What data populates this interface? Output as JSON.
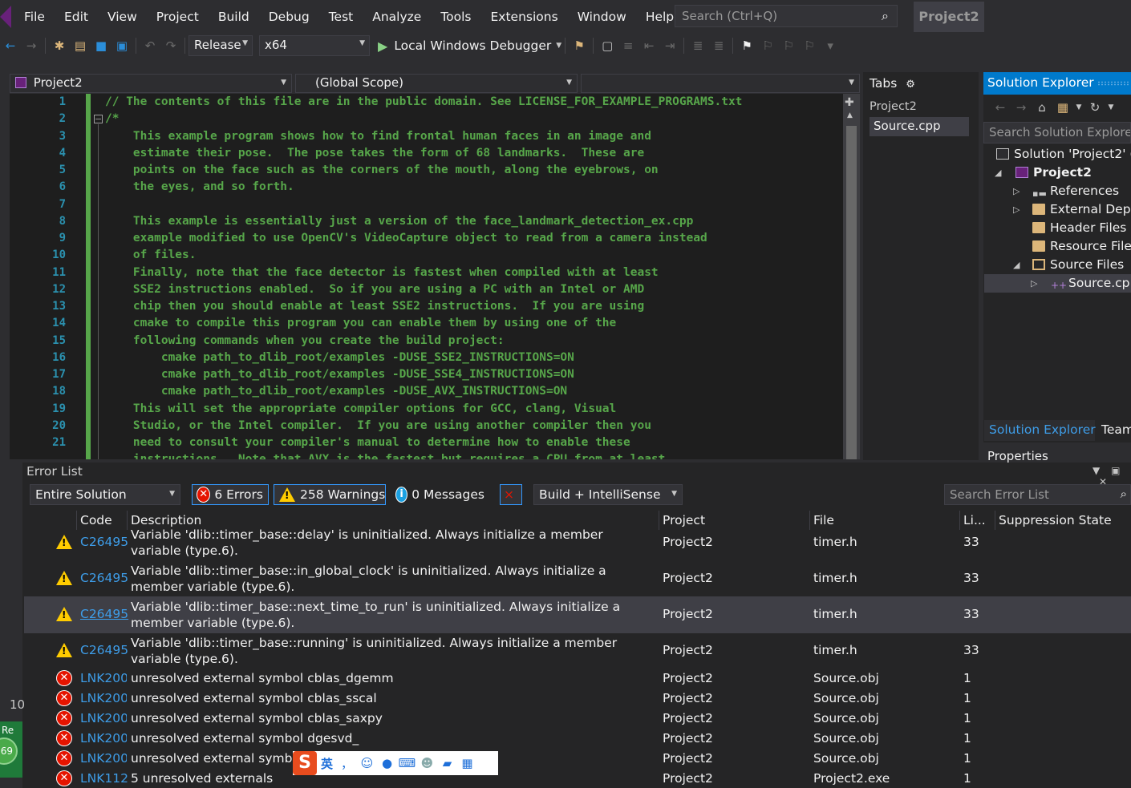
{
  "menu": {
    "items": [
      "File",
      "Edit",
      "View",
      "Project",
      "Build",
      "Debug",
      "Test",
      "Analyze",
      "Tools",
      "Extensions",
      "Window",
      "Help"
    ],
    "search_placeholder": "Search (Ctrl+Q)",
    "project_name": "Project2"
  },
  "toolbar": {
    "configuration": "Release",
    "platform": "x64",
    "run_label": "Local Windows Debugger"
  },
  "editor_nav": {
    "project": "Project2",
    "scope": "(Global Scope)",
    "member": ""
  },
  "editor": {
    "line_numbers": [
      "1",
      "2",
      "3",
      "4",
      "5",
      "6",
      "7",
      "8",
      "9",
      "10",
      "11",
      "12",
      "13",
      "14",
      "15",
      "16",
      "17",
      "18",
      "19",
      "20",
      "21"
    ],
    "lines": [
      "// The contents of this file are in the public domain. See LICENSE_FOR_EXAMPLE_PROGRAMS.txt",
      "/*",
      "    This example program shows how to find frontal human faces in an image and",
      "    estimate their pose.  The pose takes the form of 68 landmarks.  These are",
      "    points on the face such as the corners of the mouth, along the eyebrows, on",
      "    the eyes, and so forth.",
      "",
      "    This example is essentially just a version of the face_landmark_detection_ex.cpp",
      "    example modified to use OpenCV's VideoCapture object to read from a camera instead",
      "    of files.",
      "    Finally, note that the face detector is fastest when compiled with at least",
      "    SSE2 instructions enabled.  So if you are using a PC with an Intel or AMD",
      "    chip then you should enable at least SSE2 instructions.  If you are using",
      "    cmake to compile this program you can enable them by using one of the",
      "    following commands when you create the build project:",
      "        cmake path_to_dlib_root/examples -DUSE_SSE2_INSTRUCTIONS=ON",
      "        cmake path_to_dlib_root/examples -DUSE_SSE4_INSTRUCTIONS=ON",
      "        cmake path_to_dlib_root/examples -DUSE_AVX_INSTRUCTIONS=ON",
      "    This will set the appropriate compiler options for GCC, clang, Visual",
      "    Studio, or the Intel compiler.  If you are using another compiler then you",
      "    need to consult your compiler's manual to determine how to enable these",
      "    instructions.  Note that AVX is the fastest but requires a CPU from at least"
    ]
  },
  "tabs_panel": {
    "title": "Tabs",
    "project": "Project2",
    "file": "Source.cpp"
  },
  "solution_explorer": {
    "title": "Solution Explorer",
    "search_placeholder": "Search Solution Explorer",
    "solution": "Solution 'Project2' (",
    "project": "Project2",
    "items": [
      "References",
      "External Depe",
      "Header Files",
      "Resource File",
      "Source Files",
      "Source.cp"
    ],
    "bottom_tab_1": "Solution Explorer",
    "bottom_tab_2": "Team",
    "properties_title": "Properties"
  },
  "error_list": {
    "title": "Error List",
    "scope_filter": "Entire Solution",
    "errors_label": "6 Errors",
    "warnings_label": "258 Warnings",
    "messages_label": "0 Messages",
    "build_filter": "Build + IntelliSense",
    "search_placeholder": "Search Error List",
    "columns": [
      "Code",
      "Description",
      "Project",
      "File",
      "Li...",
      "Suppression State"
    ],
    "rows": [
      {
        "type": "warning",
        "code": "C26495",
        "description": "Variable 'dlib::timer_base::delay' is uninitialized. Always initialize a member variable (type.6).",
        "project": "Project2",
        "file": "timer.h",
        "line": "33"
      },
      {
        "type": "warning",
        "code": "C26495",
        "description": "Variable 'dlib::timer_base::in_global_clock' is uninitialized. Always initialize a member variable (type.6).",
        "project": "Project2",
        "file": "timer.h",
        "line": "33"
      },
      {
        "type": "warning",
        "code": "C26495",
        "description": "Variable 'dlib::timer_base::next_time_to_run' is uninitialized. Always initialize a member variable (type.6).",
        "project": "Project2",
        "file": "timer.h",
        "line": "33"
      },
      {
        "type": "warning",
        "code": "C26495",
        "description": "Variable 'dlib::timer_base::running' is uninitialized. Always initialize a member variable (type.6).",
        "project": "Project2",
        "file": "timer.h",
        "line": "33"
      },
      {
        "type": "error",
        "code": "LNK200",
        "description": "unresolved external symbol cblas_dgemm",
        "project": "Project2",
        "file": "Source.obj",
        "line": "1"
      },
      {
        "type": "error",
        "code": "LNK200",
        "description": "unresolved external symbol cblas_sscal",
        "project": "Project2",
        "file": "Source.obj",
        "line": "1"
      },
      {
        "type": "error",
        "code": "LNK200",
        "description": "unresolved external symbol cblas_saxpy",
        "project": "Project2",
        "file": "Source.obj",
        "line": "1"
      },
      {
        "type": "error",
        "code": "LNK200",
        "description": "unresolved external symbol dgesvd_",
        "project": "Project2",
        "file": "Source.obj",
        "line": "1"
      },
      {
        "type": "error",
        "code": "LNK200",
        "description": "unresolved external symbol",
        "project": "Project2",
        "file": "Source.obj",
        "line": "1"
      },
      {
        "type": "error",
        "code": "LNK112",
        "description": "5 unresolved externals",
        "project": "Project2",
        "file": "Project2.exe",
        "line": "1"
      }
    ]
  },
  "left_edge": {
    "number": "10",
    "bubble_text": "Re",
    "badge": "69"
  },
  "ime": {
    "logo": "S",
    "lang": "英"
  }
}
